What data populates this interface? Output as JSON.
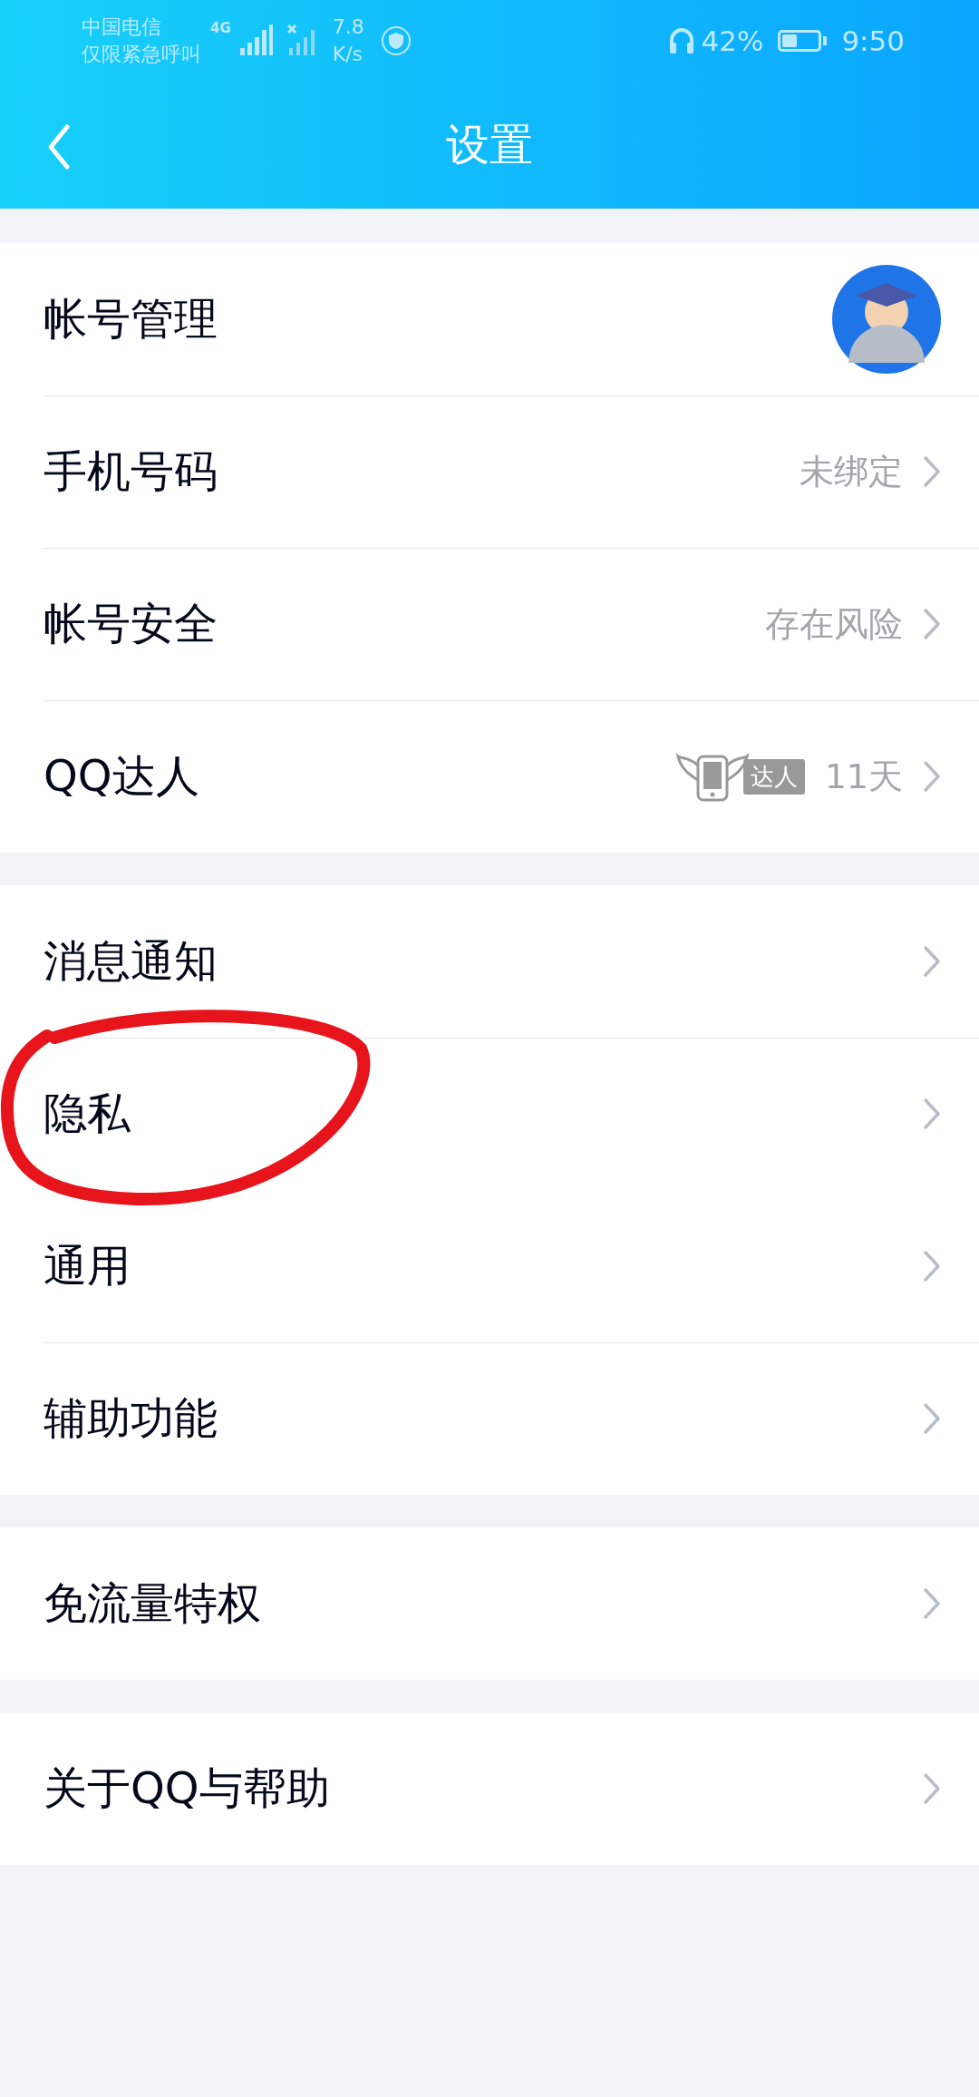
{
  "status_bar": {
    "carrier": "中国电信",
    "carrier_note": "仅限紧急呼叫",
    "network": "4G",
    "speed_value": "7.8",
    "speed_unit": "K/s",
    "battery_text": "42%",
    "time": "9:50"
  },
  "header": {
    "title": "设置"
  },
  "groups": [
    {
      "rows": [
        {
          "kind": "avatar",
          "label": "帐号管理",
          "circled": false
        },
        {
          "kind": "value",
          "label": "手机号码",
          "value": "未绑定",
          "circled": false
        },
        {
          "kind": "value",
          "label": "帐号安全",
          "value": "存在风险",
          "circled": false
        },
        {
          "kind": "badge",
          "label": "QQ达人",
          "badge": "达人",
          "value": "11天",
          "circled": false
        }
      ]
    },
    {
      "rows": [
        {
          "kind": "plain",
          "label": "消息通知",
          "circled": false
        },
        {
          "kind": "plain",
          "label": "隐私",
          "circled": true
        },
        {
          "kind": "plain",
          "label": "通用",
          "circled": false
        },
        {
          "kind": "plain",
          "label": "辅助功能",
          "circled": false
        }
      ]
    },
    {
      "rows": [
        {
          "kind": "plain",
          "label": "免流量特权",
          "circled": false
        }
      ]
    },
    {
      "rows": [
        {
          "kind": "plain",
          "label": "关于QQ与帮助",
          "circled": false
        }
      ]
    }
  ]
}
